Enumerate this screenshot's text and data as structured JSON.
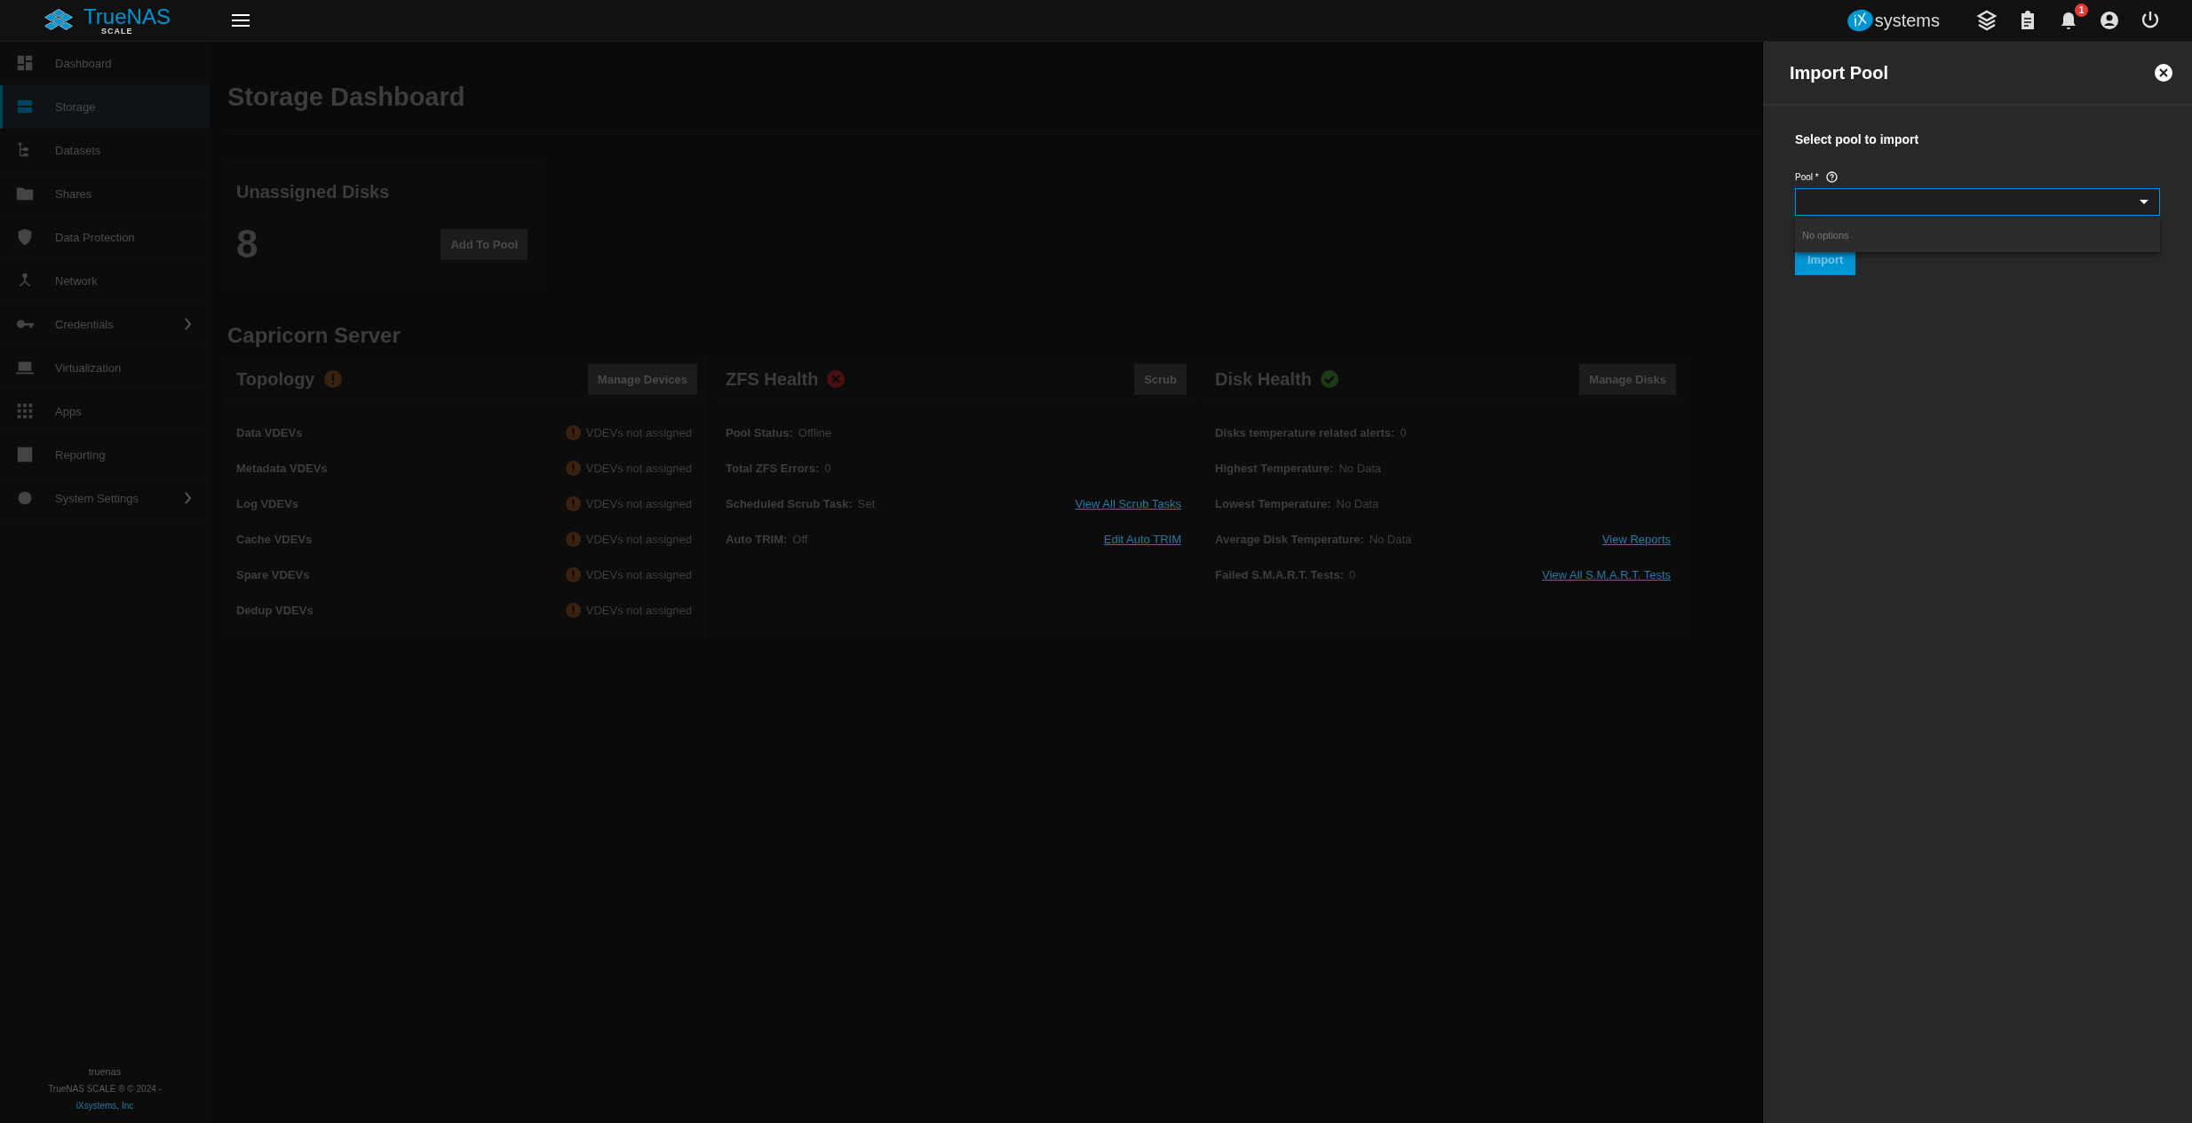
{
  "header": {
    "logo_text": "TrueNAS",
    "logo_sub": "SCALE",
    "vendor_mark": "iX",
    "vendor_text": "systems",
    "notification_count": "1"
  },
  "sidebar": {
    "items": [
      {
        "label": "Dashboard",
        "selected": false,
        "submenu": false
      },
      {
        "label": "Storage",
        "selected": true,
        "submenu": false
      },
      {
        "label": "Datasets",
        "selected": false,
        "submenu": false
      },
      {
        "label": "Shares",
        "selected": false,
        "submenu": false
      },
      {
        "label": "Data Protection",
        "selected": false,
        "submenu": false
      },
      {
        "label": "Network",
        "selected": false,
        "submenu": false
      },
      {
        "label": "Credentials",
        "selected": false,
        "submenu": true
      },
      {
        "label": "Virtualization",
        "selected": false,
        "submenu": false
      },
      {
        "label": "Apps",
        "selected": false,
        "submenu": false
      },
      {
        "label": "Reporting",
        "selected": false,
        "submenu": false
      },
      {
        "label": "System Settings",
        "selected": false,
        "submenu": true
      }
    ],
    "hostname": "truenas",
    "copyright": "TrueNAS SCALE ® © 2024 -",
    "company_link": "iXsystems, Inc"
  },
  "page_title": "Storage Dashboard",
  "unassigned": {
    "title": "Unassigned Disks",
    "count": "8",
    "button": "Add To Pool"
  },
  "pool_name": "Capricorn Server",
  "cards": [
    {
      "title": "Topology",
      "kind": "warning",
      "button": "Manage Devices",
      "rows": [
        {
          "label": "Data VDEVs",
          "kind": "warning",
          "value": "VDEVs not assigned"
        },
        {
          "label": "Metadata VDEVs",
          "kind": "warning",
          "value": "VDEVs not assigned"
        },
        {
          "label": "Log VDEVs",
          "kind": "warning",
          "value": "VDEVs not assigned"
        },
        {
          "label": "Cache VDEVs",
          "kind": "warning",
          "value": "VDEVs not assigned"
        },
        {
          "label": "Spare VDEVs",
          "kind": "warning",
          "value": "VDEVs not assigned"
        },
        {
          "label": "Dedup VDEVs",
          "kind": "warning",
          "value": "VDEVs not assigned"
        }
      ]
    },
    {
      "title": "ZFS Health",
      "kind": "error",
      "button": "Scrub",
      "rows": [
        {
          "label": "Pool Status:",
          "kind": "field",
          "value": "Offline"
        },
        {
          "label": "Total ZFS Errors:",
          "kind": "field",
          "value": "0"
        },
        {
          "label": "Scheduled Scrub Task:",
          "kind": "field",
          "value": "Set",
          "link": "View All Scrub Tasks"
        },
        {
          "label": "Auto TRIM:",
          "kind": "field",
          "value": "Off",
          "link": "Edit Auto TRIM"
        }
      ]
    },
    {
      "title": "Disk Health",
      "kind": "ok",
      "button": "Manage Disks",
      "rows": [
        {
          "label": "Disks temperature related alerts:",
          "kind": "field",
          "value": "0"
        },
        {
          "label": "Highest Temperature:",
          "kind": "field",
          "value": "No Data"
        },
        {
          "label": "Lowest Temperature:",
          "kind": "field",
          "value": "No Data"
        },
        {
          "label": "Average Disk Temperature:",
          "kind": "field",
          "value": "No Data",
          "link": "View Reports"
        },
        {
          "label": "Failed S.M.A.R.T. Tests:",
          "kind": "field",
          "value": "0",
          "link": "View All S.M.A.R.T. Tests"
        }
      ]
    }
  ],
  "panel": {
    "title": "Import Pool",
    "subtitle": "Select pool to import",
    "field_label": "Pool *",
    "dropdown_open": true,
    "dropdown_message": "No options",
    "button": "Import"
  }
}
